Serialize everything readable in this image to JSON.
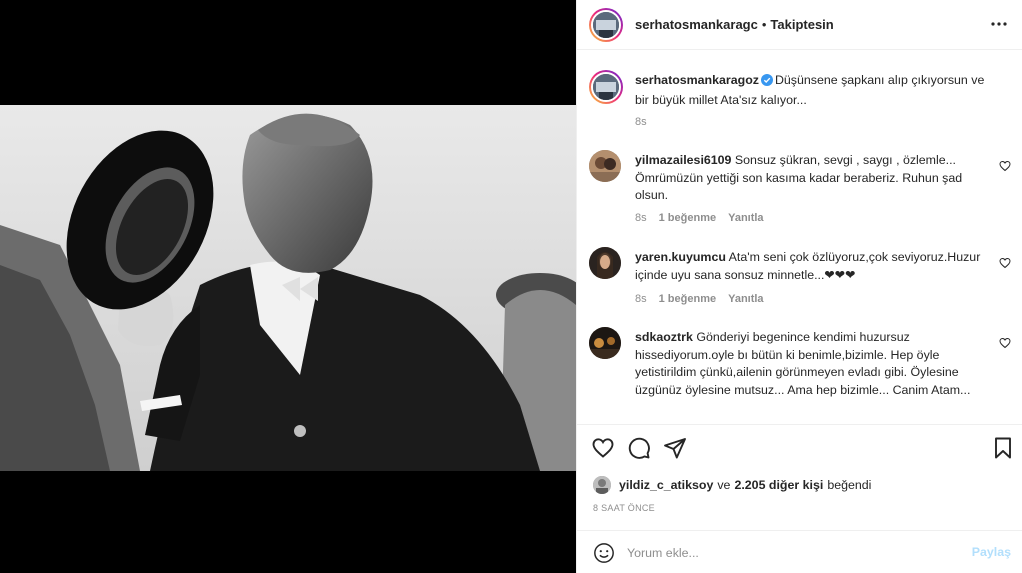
{
  "post": {
    "author": {
      "username": "serhatosmankaragoz",
      "username_truncated": "serhatosmankaragc",
      "separator": "•",
      "follow_state": "Takiptesin"
    },
    "caption": {
      "username": "serhatosmankaragoz",
      "text": "Düşünsene şapkanı alıp çıkıyorsun ve bir büyük millet Ata'sız kalıyor...",
      "age": "8s"
    },
    "comments": [
      {
        "username": "yilmazailesi6109",
        "text": "Sonsuz şükran, sevgi , saygı , özlemle... Ömrümüzün yettiği son kasıma kadar beraberiz. Ruhun şad olsun.",
        "age": "8s",
        "likes": "1 beğenme",
        "reply": "Yanıtla"
      },
      {
        "username": "yaren.kuyumcu",
        "text": "Ata'm seni çok özlüyoruz,çok seviyoruz.Huzur içinde uyu sana sonsuz minnetle...❤❤❤",
        "age": "8s",
        "likes": "1 beğenme",
        "reply": "Yanıtla"
      },
      {
        "username": "sdkaoztrk",
        "text": "Gönderiyi begenince kendimi huzursuz hissediyorum.oyle bı bütün ki benimle,bizimle. Hep öyle yetistirildim çünkü,ailenin görünmeyen evladı gibi. Öylesine üzgünüz öylesine mutsuz... Ama hep bizimle... Canim Atam..."
      }
    ],
    "liked_by": {
      "first_user": "yildiz_c_atiksoy",
      "conjunction": "ve",
      "others": "2.205 diğer kişi",
      "suffix": "beğendi"
    },
    "timestamp": "8 SAAT ÖNCE",
    "composer": {
      "placeholder": "Yorum ekle...",
      "submit_label": "Paylaş"
    }
  },
  "icons": {
    "more": "more-horizontal-icon",
    "like": "heart-icon",
    "comment": "comment-icon",
    "share": "share-icon",
    "save": "bookmark-icon",
    "emoji": "emoji-icon",
    "verified": "verified-badge-icon",
    "comment_like": "heart-icon"
  },
  "colors": {
    "text": "#262626",
    "muted": "#8e8e8e",
    "verified": "#3897f0",
    "post_disabled": "#b2dffc",
    "border": "#efefef"
  }
}
